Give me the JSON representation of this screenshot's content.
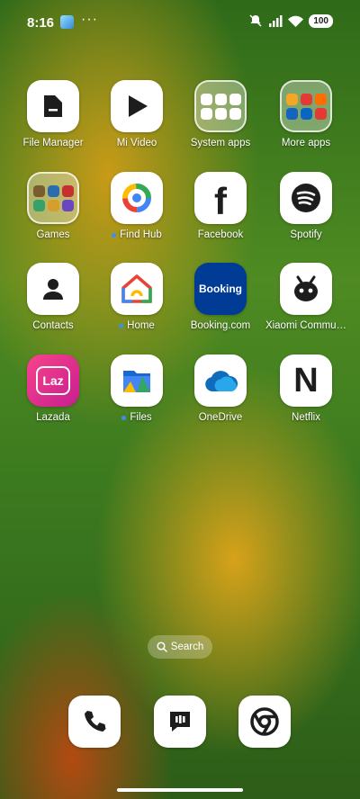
{
  "status_bar": {
    "time": "8:16",
    "extra_icon": "app-notification-icon",
    "overflow": "···",
    "battery": "100"
  },
  "apps": [
    {
      "label": "File Manager",
      "icon": "folder-icon"
    },
    {
      "label": "Mi Video",
      "icon": "play-icon"
    },
    {
      "label": "System apps",
      "icon": "folder-grid-icon"
    },
    {
      "label": "More apps",
      "icon": "folder-grid-icon"
    },
    {
      "label": "Games",
      "icon": "folder-grid-icon"
    },
    {
      "label": "Find Hub",
      "icon": "find-hub-icon"
    },
    {
      "label": "Facebook",
      "icon": "facebook-icon"
    },
    {
      "label": "Spotify",
      "icon": "spotify-icon"
    },
    {
      "label": "Contacts",
      "icon": "person-icon"
    },
    {
      "label": "Home",
      "icon": "google-home-icon"
    },
    {
      "label": "Booking.com",
      "icon": "booking-icon",
      "icon_text": "Booking"
    },
    {
      "label": "Xiaomi Commu…",
      "icon": "xiaomi-community-icon"
    },
    {
      "label": "Lazada",
      "icon": "lazada-icon",
      "icon_text": "Laz"
    },
    {
      "label": "Files",
      "icon": "files-icon"
    },
    {
      "label": "OneDrive",
      "icon": "onedrive-icon"
    },
    {
      "label": "Netflix",
      "icon": "netflix-icon",
      "icon_text": "N"
    }
  ],
  "search": {
    "label": "Search"
  },
  "dock": [
    {
      "name": "Phone",
      "icon": "phone-icon"
    },
    {
      "name": "Messages",
      "icon": "message-icon"
    },
    {
      "name": "Chrome",
      "icon": "chrome-icon"
    }
  ],
  "colors": {
    "accent_dot": "#3c8ef5",
    "booking": "#003b95",
    "lazada": "#e7208b"
  }
}
